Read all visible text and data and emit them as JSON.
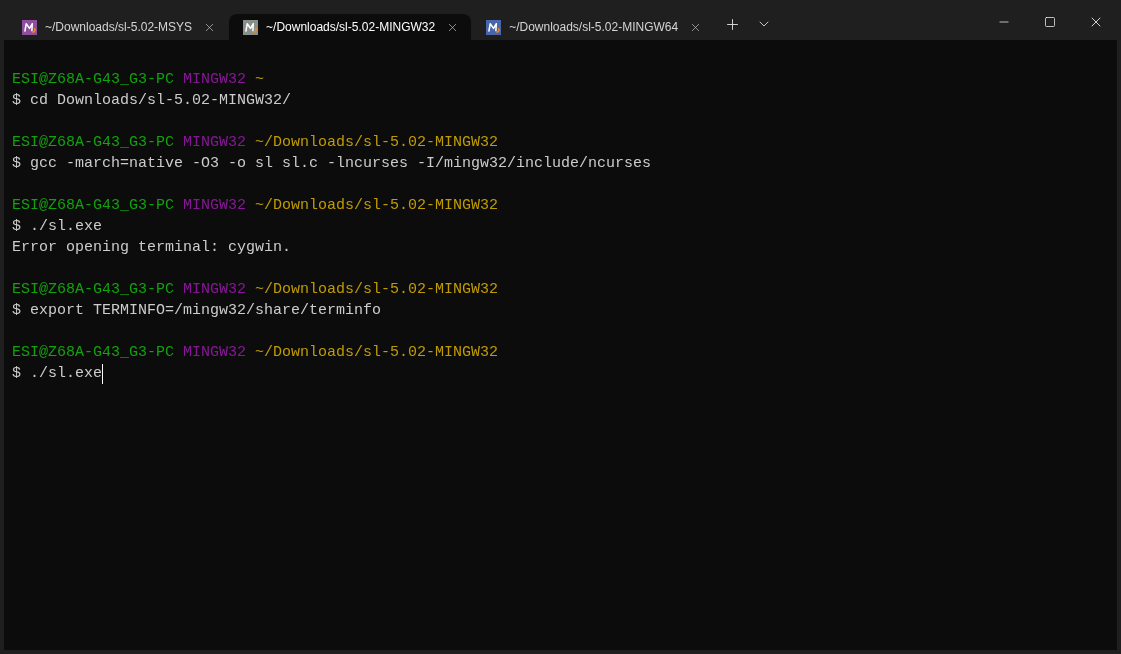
{
  "tabs": [
    {
      "title": "~/Downloads/sl-5.02-MSYS",
      "selected": false,
      "color": "#8e4f9e"
    },
    {
      "title": "~/Downloads/sl-5.02-MINGW32",
      "selected": true,
      "color": "#87918a"
    },
    {
      "title": "~/Downloads/sl-5.02-MINGW64",
      "selected": false,
      "color": "#4a66aa"
    }
  ],
  "terminal": {
    "lines": [
      {
        "kind": "prompt",
        "user": "ESI@Z68A-G43_G3-PC",
        "system": "MINGW32",
        "path": "~"
      },
      {
        "kind": "command",
        "text": "$ cd Downloads/sl-5.02-MINGW32/",
        "cursor": false
      },
      {
        "kind": "blank"
      },
      {
        "kind": "prompt",
        "user": "ESI@Z68A-G43_G3-PC",
        "system": "MINGW32",
        "path": "~/Downloads/sl-5.02-MINGW32"
      },
      {
        "kind": "command",
        "text": "$ gcc -march=native -O3 -o sl sl.c -lncurses -I/mingw32/include/ncurses",
        "cursor": false
      },
      {
        "kind": "blank"
      },
      {
        "kind": "prompt",
        "user": "ESI@Z68A-G43_G3-PC",
        "system": "MINGW32",
        "path": "~/Downloads/sl-5.02-MINGW32"
      },
      {
        "kind": "command",
        "text": "$ ./sl.exe",
        "cursor": false
      },
      {
        "kind": "output",
        "text": "Error opening terminal: cygwin."
      },
      {
        "kind": "blank"
      },
      {
        "kind": "prompt",
        "user": "ESI@Z68A-G43_G3-PC",
        "system": "MINGW32",
        "path": "~/Downloads/sl-5.02-MINGW32"
      },
      {
        "kind": "command",
        "text": "$ export TERMINFO=/mingw32/share/terminfo",
        "cursor": false
      },
      {
        "kind": "blank"
      },
      {
        "kind": "prompt",
        "user": "ESI@Z68A-G43_G3-PC",
        "system": "MINGW32",
        "path": "~/Downloads/sl-5.02-MINGW32"
      },
      {
        "kind": "command",
        "text": "$ ./sl.exe",
        "cursor": true
      }
    ]
  }
}
